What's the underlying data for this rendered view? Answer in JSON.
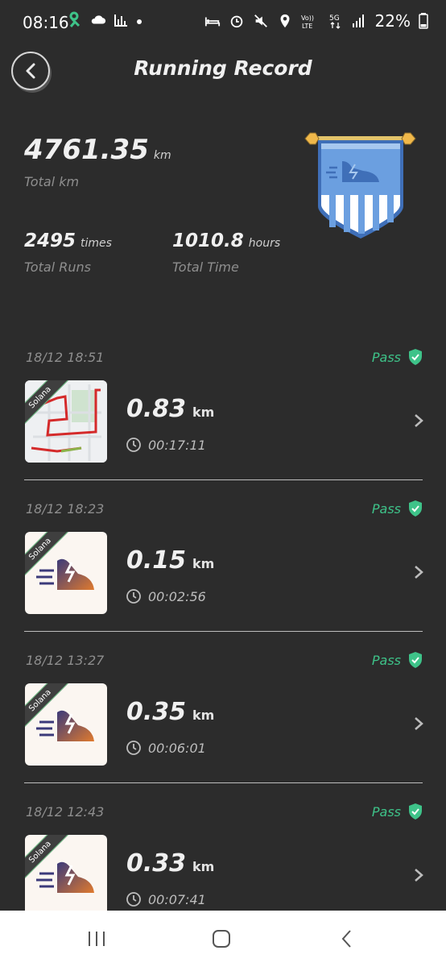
{
  "status": {
    "time": "08:16",
    "battery": "22%"
  },
  "header": {
    "title": "Running Record"
  },
  "summary": {
    "total_km": "4761.35",
    "total_km_unit": "km",
    "total_km_label": "Total km",
    "runs": "2495",
    "runs_unit": "times",
    "runs_label": "Total Runs",
    "time": "1010.8",
    "time_unit": "hours",
    "time_label": "Total Time"
  },
  "records": [
    {
      "date": "18/12 18:51",
      "status": "Pass",
      "distance": "0.83",
      "unit": "km",
      "duration": "00:17:11",
      "badge": "Solana",
      "thumb": "route-map"
    },
    {
      "date": "18/12 18:23",
      "status": "Pass",
      "distance": "0.15",
      "unit": "km",
      "duration": "00:02:56",
      "badge": "Solana",
      "thumb": "running-shoe-icon"
    },
    {
      "date": "18/12 13:27",
      "status": "Pass",
      "distance": "0.35",
      "unit": "km",
      "duration": "00:06:01",
      "badge": "Solana",
      "thumb": "running-shoe-icon"
    },
    {
      "date": "18/12 12:43",
      "status": "Pass",
      "distance": "0.33",
      "unit": "km",
      "duration": "00:07:41",
      "badge": "Solana",
      "thumb": "running-shoe-icon"
    }
  ],
  "colors": {
    "background": "#2c2c2c",
    "pass": "#3ec389",
    "banner": "#6b9fe0"
  }
}
